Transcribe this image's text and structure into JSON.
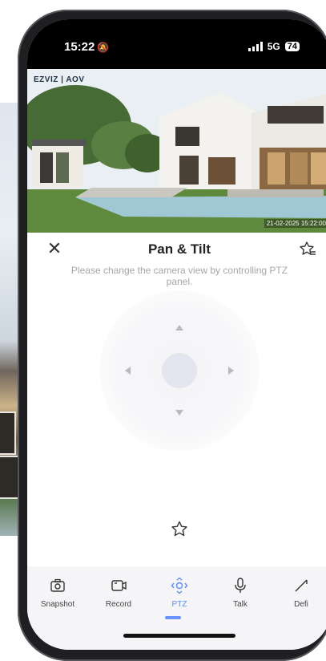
{
  "status_bar": {
    "time": "15:22",
    "signal_type": "5G",
    "battery": "74",
    "bell_icon": "bell-off-icon"
  },
  "camera": {
    "logo": "EZVIZ | AOV",
    "timestamp": "21-02-2025 15:22:00"
  },
  "ptz": {
    "title": "Pan & Tilt",
    "hint": "Please change the camera view by controlling PTZ panel.",
    "close_icon": "close-icon",
    "favorites_list_icon": "star-list-icon",
    "favorite_icon": "star-icon"
  },
  "toolbar": {
    "items": [
      {
        "label": "Snapshot",
        "icon": "camera-icon"
      },
      {
        "label": "Record",
        "icon": "video-record-icon"
      },
      {
        "label": "PTZ",
        "icon": "ptz-icon",
        "active": true
      },
      {
        "label": "Talk",
        "icon": "microphone-icon"
      },
      {
        "label": "Defi",
        "icon": "definition-icon"
      }
    ]
  },
  "colors": {
    "accent": "#5a8dff",
    "text": "#222222",
    "hint": "#a6a6ab",
    "toolbar_bg": "#f5f5f8"
  }
}
